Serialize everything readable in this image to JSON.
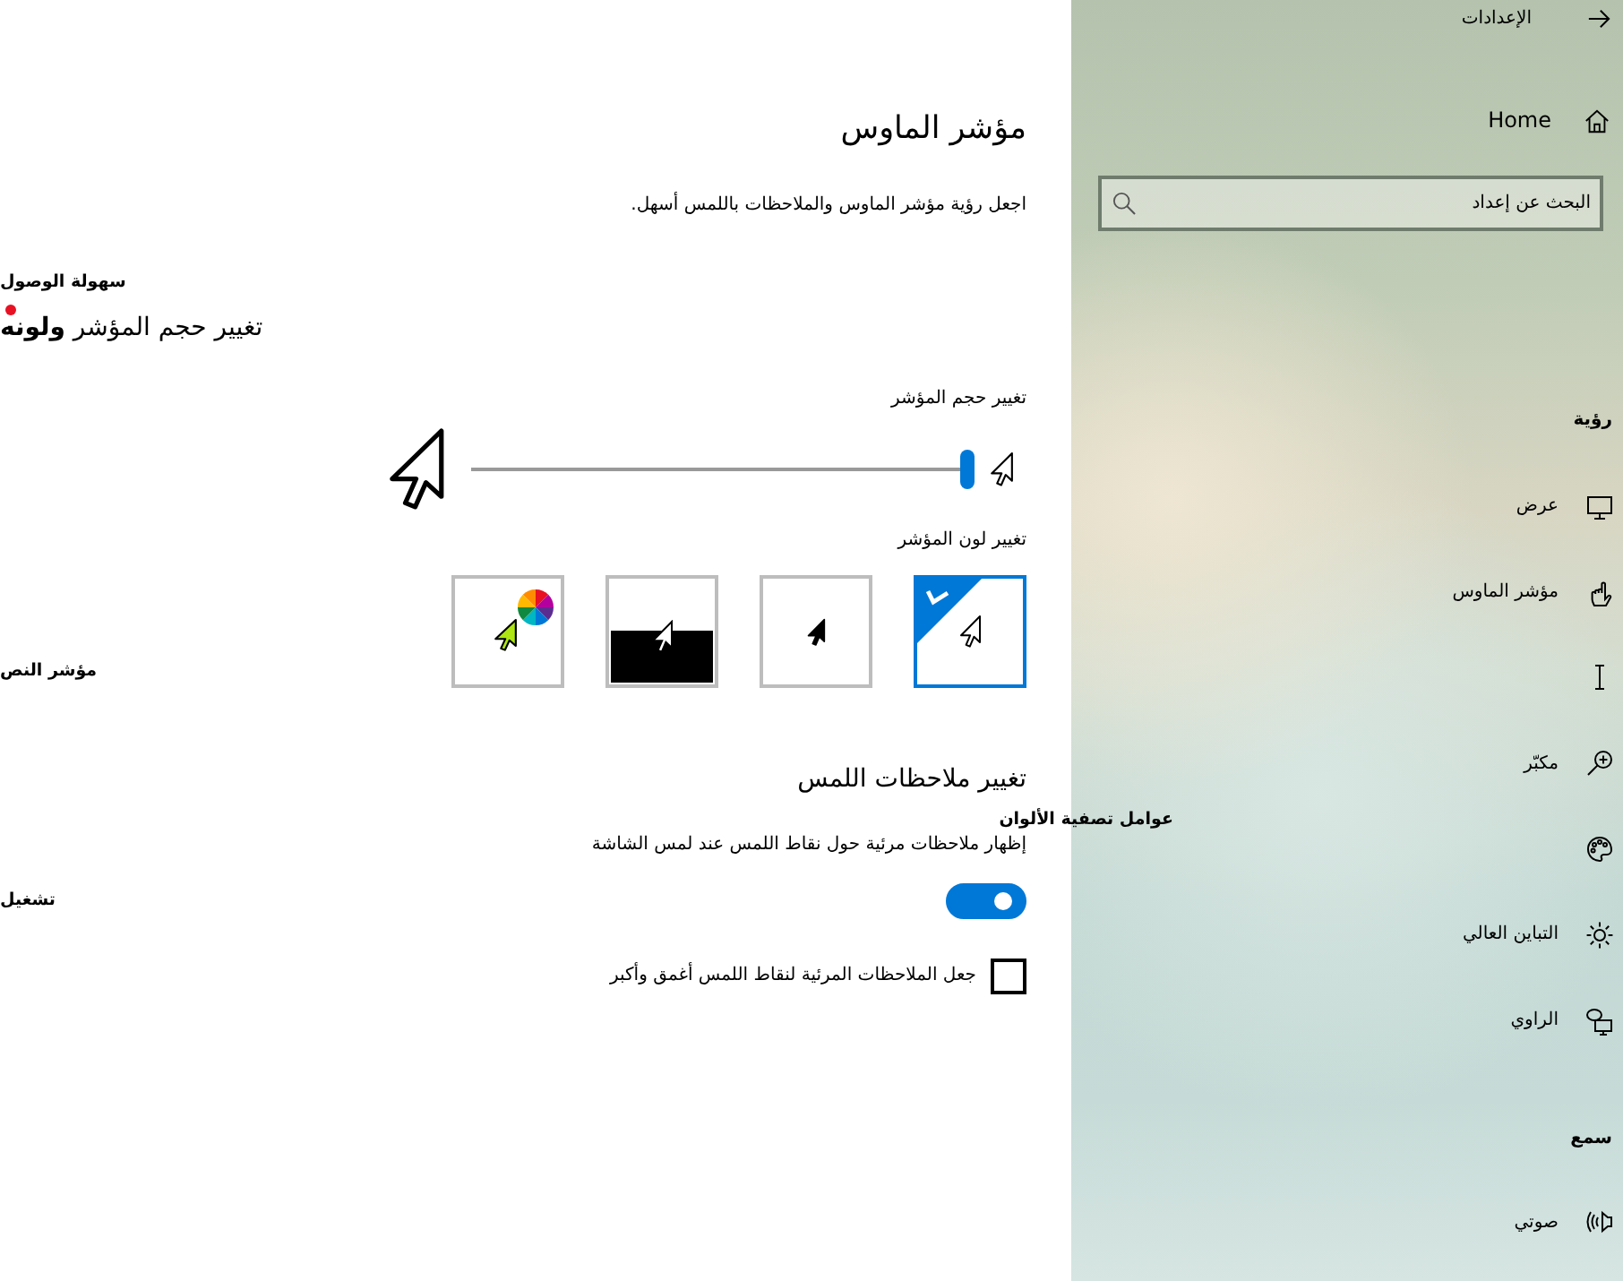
{
  "window": {
    "title": "الإعدادات"
  },
  "sidebar": {
    "home": "Home",
    "search": {
      "placeholder": "البحث عن إعداد"
    },
    "sections": [
      {
        "heading": "رؤية",
        "items": [
          {
            "kind": "display",
            "label": "عرض"
          },
          {
            "kind": "pointer",
            "label": "مؤشر الماوس"
          },
          {
            "kind": "textcursor"
          },
          {
            "kind": "magnifier",
            "label": "مكبّر"
          },
          {
            "kind": "palette"
          },
          {
            "kind": "contrast",
            "label": "التباين العالي"
          },
          {
            "kind": "narrator",
            "label": "الراوي"
          }
        ]
      },
      {
        "heading": "سمع",
        "items": [
          {
            "kind": "audio",
            "label": "صوتي"
          }
        ]
      }
    ]
  },
  "page": {
    "title": "مؤشر الماوس",
    "subtitle": "اجعل رؤية مؤشر الماوس والملاحظات باللمس أسهل.",
    "size": {
      "label": "تغيير حجم المؤشر",
      "level": 0
    },
    "color": {
      "label": "تغيير لون المؤشر",
      "options": [
        {
          "kind": "white",
          "selected": true
        },
        {
          "kind": "black",
          "selected": false
        },
        {
          "kind": "inverted",
          "selected": false
        },
        {
          "kind": "custom",
          "selected": false
        }
      ]
    },
    "touch": {
      "heading": "تغيير ملاحظات اللمس",
      "feedback": {
        "label": "إظهار ملاحظات مرئية حول نقاط اللمس عند لمس الشاشة",
        "on": true
      },
      "darker": {
        "label": "جعل الملاحظات المرئية لنقاط اللمس أغمق وأكبر",
        "checked": false
      }
    }
  },
  "loose_labels": [
    "سهولة الوصول",
    "تغيير حجم المؤشر **ولونه**",
    "مؤشر النص",
    "عوامل تصفية الألوان",
    "تشغيل"
  ]
}
